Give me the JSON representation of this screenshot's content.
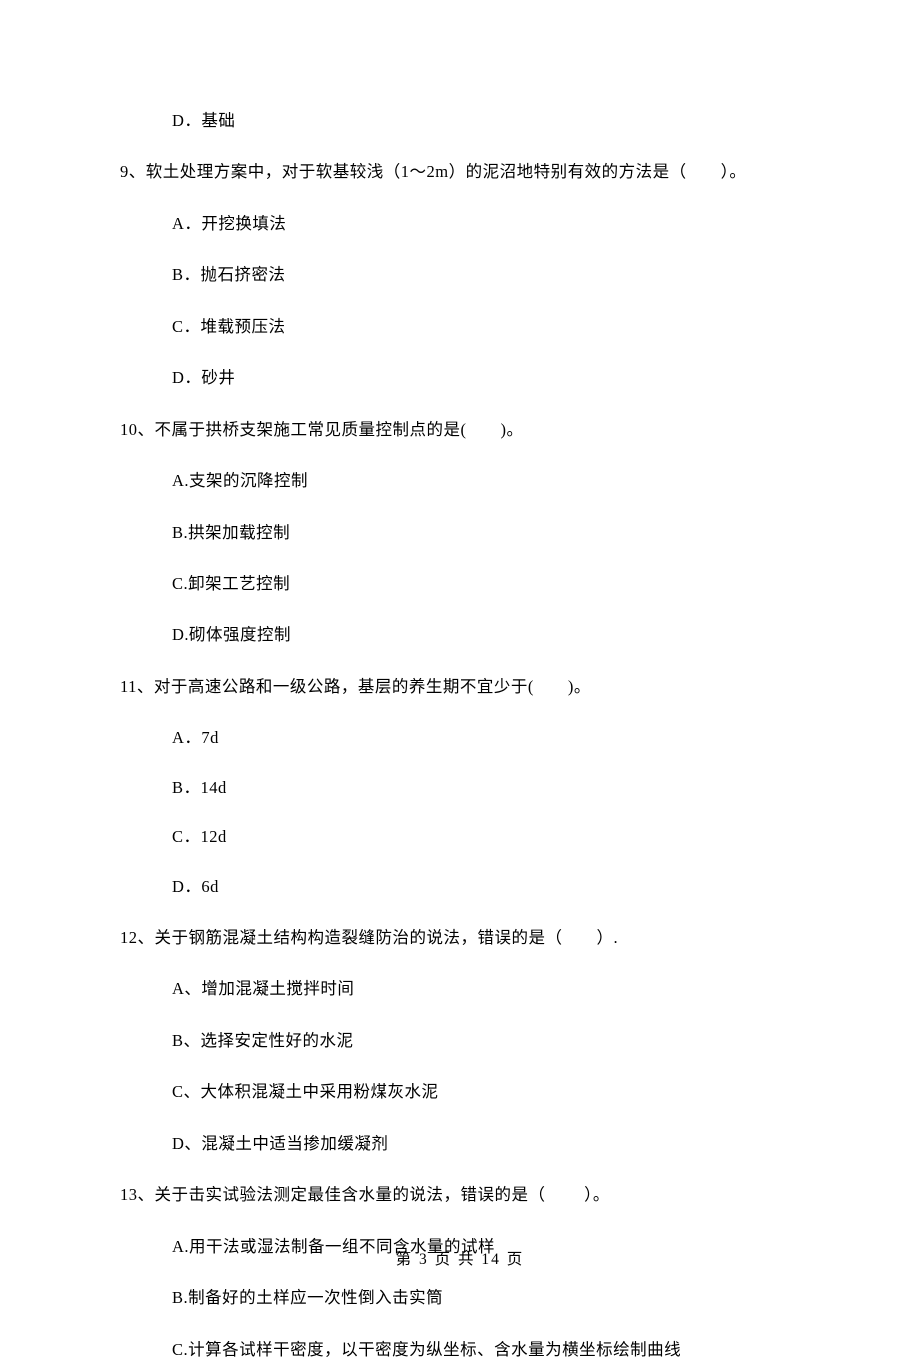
{
  "q8_optD": "D．基础",
  "q9": {
    "text": "9、软土处理方案中，对于软基较浅（1～2m）的泥沼地特别有效的方法是（　　）。",
    "A": "A．开挖换填法",
    "B": "B．抛石挤密法",
    "C": "C．堆载预压法",
    "D": "D．砂井"
  },
  "q10": {
    "text": "10、不属于拱桥支架施工常见质量控制点的是(　　)。",
    "A": "A.支架的沉降控制",
    "B": "B.拱架加载控制",
    "C": "C.卸架工艺控制",
    "D": "D.砌体强度控制"
  },
  "q11": {
    "text": "11、对于高速公路和一级公路，基层的养生期不宜少于(　　)。",
    "A": "A．7d",
    "B": "B．14d",
    "C": "C．12d",
    "D": "D．6d"
  },
  "q12": {
    "text": "12、关于钢筋混凝土结构构造裂缝防治的说法，错误的是（　　）.",
    "A": "A、增加混凝土搅拌时间",
    "B": "B、选择安定性好的水泥",
    "C": "C、大体积混凝土中采用粉煤灰水泥",
    "D": "D、混凝土中适当掺加缓凝剂"
  },
  "q13": {
    "text": "13、关于击实试验法测定最佳含水量的说法，错误的是（ 　　）。",
    "A": "A.用干法或湿法制备一组不同含水量的试样",
    "B": "B.制备好的土样应一次性倒入击实筒",
    "C": "C.计算各试样干密度，以干密度为纵坐标、含水量为横坐标绘制曲线"
  },
  "footer": "第 3 页 共 14 页"
}
